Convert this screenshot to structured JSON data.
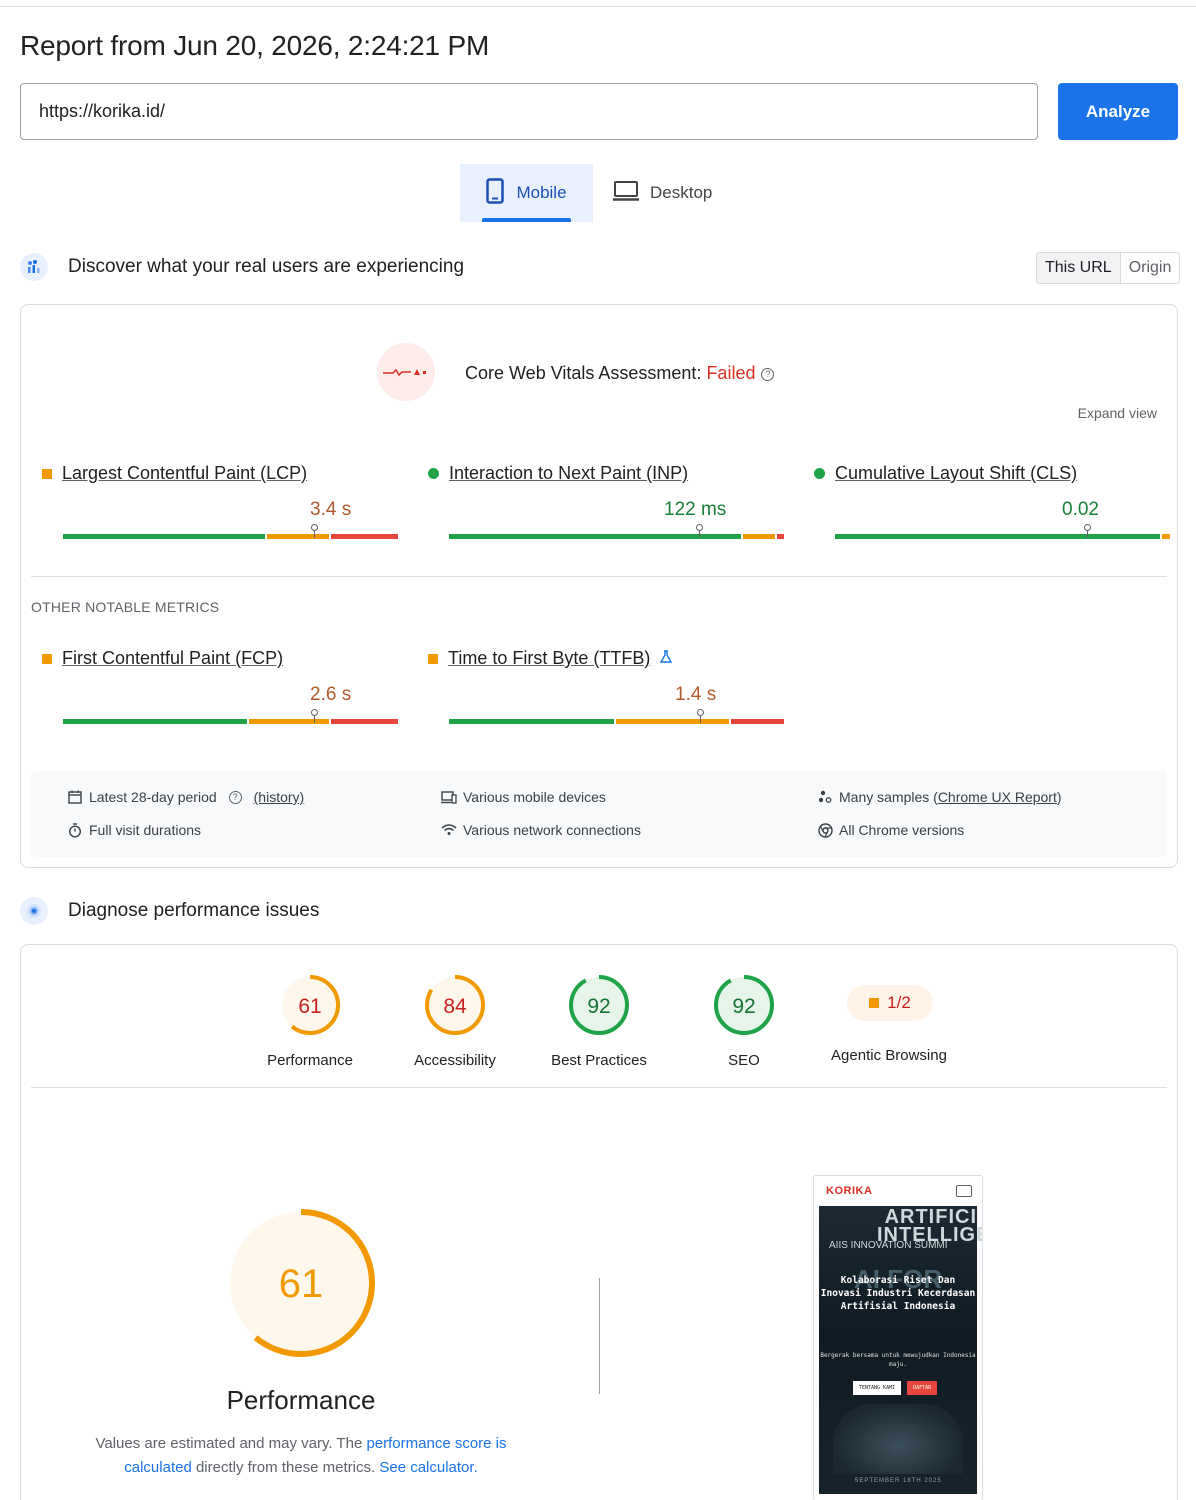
{
  "report": {
    "title": "Report from Jun 20, 2026, 2:24:21 PM"
  },
  "search": {
    "url": "https://korika.id/",
    "analyze_label": "Analyze"
  },
  "tabs": {
    "mobile": "Mobile",
    "desktop": "Desktop"
  },
  "field": {
    "heading": "Discover what your real users are experiencing",
    "toggle": {
      "this_url": "This URL",
      "origin": "Origin"
    },
    "assessment_label": "Core Web Vitals Assessment: ",
    "assessment_status": "Failed",
    "expand_label": "Expand view",
    "metrics": [
      {
        "label": "Largest Contentful Paint (LCP)",
        "value": "3.4 s",
        "status": "needs-improvement",
        "pin_fraction": 0.75
      },
      {
        "label": "Interaction to Next Paint (INP)",
        "value": "122 ms",
        "status": "good",
        "pin_fraction": 0.75
      },
      {
        "label": "Cumulative Layout Shift (CLS)",
        "value": "0.02",
        "status": "good",
        "pin_fraction": 0.75
      }
    ],
    "other_title": "OTHER NOTABLE METRICS",
    "other_metrics": [
      {
        "label": "First Contentful Paint (FCP)",
        "value": "2.6 s",
        "status": "needs-improvement",
        "pin_fraction": 0.75
      },
      {
        "label": "Time to First Byte (TTFB)",
        "value": "1.4 s",
        "status": "needs-improvement",
        "pin_fraction": 0.75
      }
    ],
    "footer": {
      "period": "Latest 28-day period",
      "history": "(history)",
      "devices": "Various mobile devices",
      "samples_prefix": "Many samples (",
      "samples_link": "Chrome UX Report",
      "samples_suffix": ")",
      "durations": "Full visit durations",
      "network": "Various network connections",
      "versions": "All Chrome versions"
    }
  },
  "lab": {
    "heading": "Diagnose performance issues",
    "scores": [
      {
        "name": "Performance",
        "value": "61",
        "score": 61,
        "color": "#f29900"
      },
      {
        "name": "Accessibility",
        "value": "84",
        "score": 84,
        "color": "#f29900"
      },
      {
        "name": "Best Practices",
        "value": "92",
        "score": 92,
        "color": "#1ea446"
      },
      {
        "name": "SEO",
        "value": "92",
        "score": 92,
        "color": "#1ea446"
      }
    ],
    "agentic": {
      "name": "Agentic Browsing",
      "value": "1/2"
    },
    "perf_big": {
      "value": "61",
      "score": 61,
      "title": "Performance"
    },
    "desc": {
      "part1": "Values are estimated and may vary. The ",
      "link1": "performance score is calculated",
      "part2": " directly from these metrics. ",
      "link2": "See calculator."
    },
    "screenshot": {
      "logo": "KORIKA",
      "hero_title": "ARTIFICI INTELLIGEN",
      "hero_tag": "AIIS  INNOVATION SUMMI",
      "hero_bg": "AI FOR",
      "hero_main": "Kolaborasi Riset Dan Inovasi Industri Kecerdasan Artifisial Indonesia",
      "hero_sub": "Bergerak bersama untuk mewujudkan Indonesia maju.",
      "btn1": "TENTANG KAMI",
      "btn2": "DAFTAR",
      "date": "SEPTEMBER 18TH 2025"
    }
  },
  "colors": {
    "good": "#1ea446",
    "average": "#f29900",
    "poor": "#e8453c",
    "accent": "#1a73e8",
    "fail": "#d93025"
  }
}
